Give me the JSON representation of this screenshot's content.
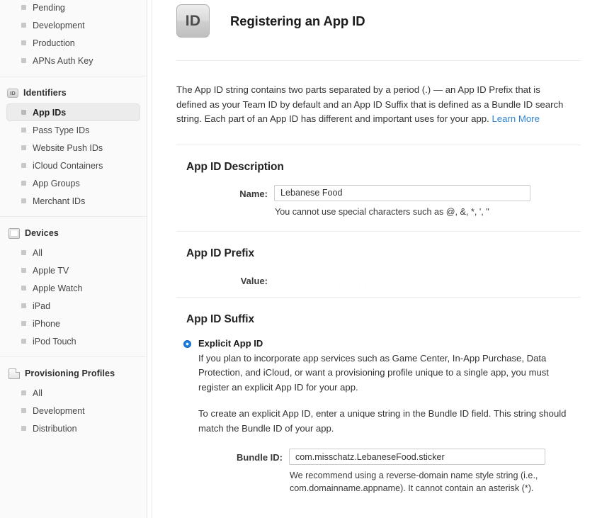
{
  "sidebar": {
    "top_items": [
      {
        "label": "Pending"
      },
      {
        "label": "Development"
      },
      {
        "label": "Production"
      },
      {
        "label": "APNs Auth Key"
      }
    ],
    "groups": [
      {
        "title": "Identifiers",
        "icon": "id-badge-icon",
        "icon_text": "ID",
        "items": [
          {
            "label": "App IDs",
            "selected": true
          },
          {
            "label": "Pass Type IDs",
            "selected": false
          },
          {
            "label": "Website Push IDs",
            "selected": false
          },
          {
            "label": "iCloud Containers",
            "selected": false
          },
          {
            "label": "App Groups",
            "selected": false
          },
          {
            "label": "Merchant IDs",
            "selected": false
          }
        ]
      },
      {
        "title": "Devices",
        "icon": "device-icon",
        "icon_text": "",
        "items": [
          {
            "label": "All",
            "selected": false
          },
          {
            "label": "Apple TV",
            "selected": false
          },
          {
            "label": "Apple Watch",
            "selected": false
          },
          {
            "label": "iPad",
            "selected": false
          },
          {
            "label": "iPhone",
            "selected": false
          },
          {
            "label": "iPod Touch",
            "selected": false
          }
        ]
      },
      {
        "title": "Provisioning Profiles",
        "icon": "document-icon",
        "icon_text": "",
        "items": [
          {
            "label": "All",
            "selected": false
          },
          {
            "label": "Development",
            "selected": false
          },
          {
            "label": "Distribution",
            "selected": false
          }
        ]
      }
    ]
  },
  "header": {
    "icon_text": "ID",
    "icon_name": "app-id-badge-icon",
    "title": "Registering an App ID"
  },
  "intro": {
    "text": "The App ID string contains two parts separated by a period (.) — an App ID Prefix that is defined as your Team ID by default and an App ID Suffix that is defined as a Bundle ID search string. Each part of an App ID has different and important uses for your app. ",
    "link_label": "Learn More"
  },
  "description_section": {
    "title": "App ID Description",
    "name_label": "Name:",
    "name_value": "Lebanese Food",
    "name_placeholder": "",
    "name_hint": "You cannot use special characters such as @, &, *, ', \""
  },
  "prefix_section": {
    "title": "App ID Prefix",
    "value_label": "Value:",
    "value_text": "..  .."
  },
  "suffix_section": {
    "title": "App ID Suffix",
    "explicit": {
      "radio_label": "Explicit App ID",
      "selected": true,
      "description": "If you plan to incorporate app services such as Game Center, In-App Purchase, Data Protection, and iCloud, or want a provisioning profile unique to a single app, you must register an explicit App ID for your app.",
      "description_2": "To create an explicit App ID, enter a unique string in the Bundle ID field. This string should match the Bundle ID of your app.",
      "bundle_label": "Bundle ID:",
      "bundle_value": "com.misschatz.LebaneseFood.sticker",
      "bundle_placeholder": "",
      "bundle_hint": "We recommend using a reverse-domain name style string (i.e., com.domainname.appname). It cannot contain an asterisk (*)."
    }
  },
  "colors": {
    "accent_blue": "#2f84d0",
    "radio_blue": "#1b7fe0",
    "sidebar_bg": "#fafafa",
    "selected_row_bg": "#ececec"
  }
}
